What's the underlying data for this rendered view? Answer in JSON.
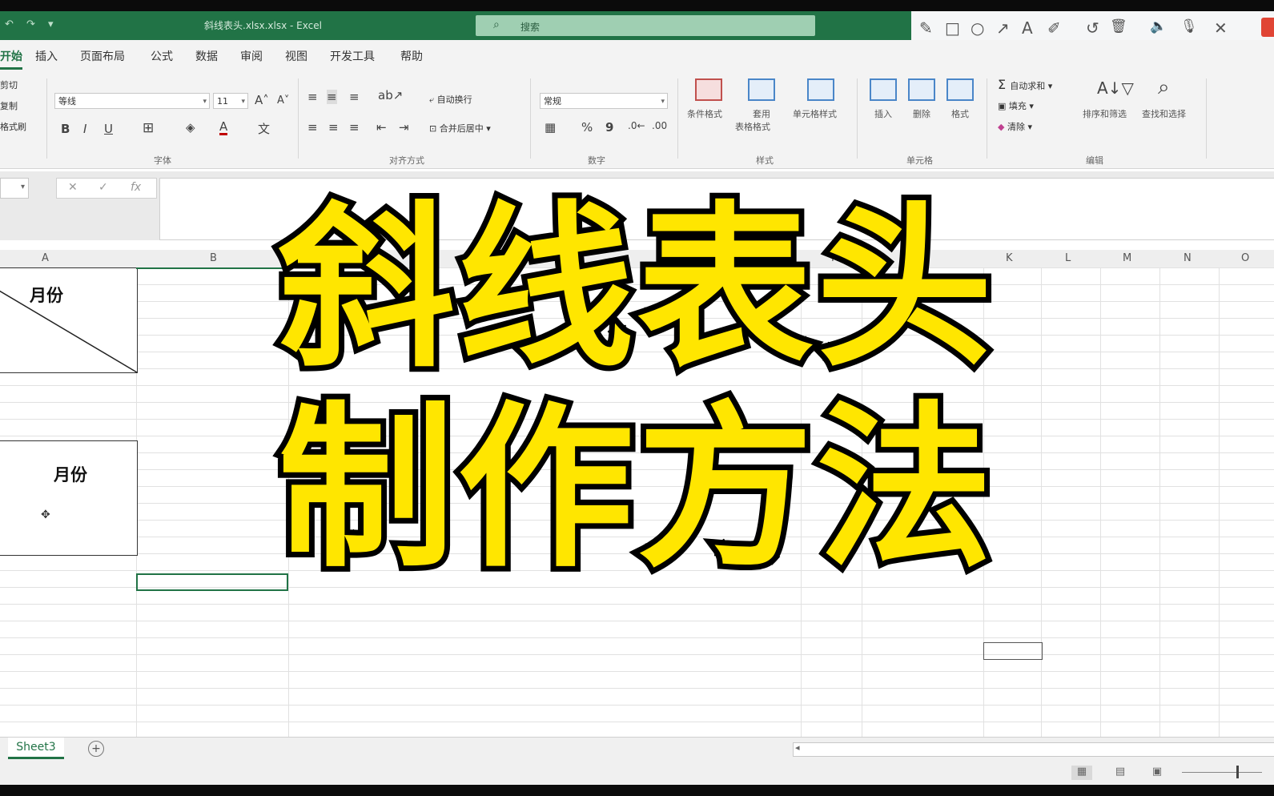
{
  "window": {
    "title": "斜线表头.xlsx.xlsx  -  Excel",
    "quick_access": "↶ ↷ ▾",
    "search_placeholder": "搜索"
  },
  "draw_toolbar": {
    "icons": [
      "pencil-icon",
      "rectangle-icon",
      "circle-icon",
      "arrow-icon",
      "text-icon",
      "highlighter-icon",
      "undo-icon",
      "trash-icon",
      "speaker-icon",
      "mic-icon",
      "close-icon"
    ],
    "glyphs": [
      "✎",
      "□",
      "○",
      "↗",
      "A",
      "✐",
      "↺",
      "🗑",
      "🔈",
      "🎙",
      "✕"
    ]
  },
  "tabs": [
    "开始",
    "插入",
    "页面布局",
    "公式",
    "数据",
    "审阅",
    "视图",
    "开发工具",
    "帮助"
  ],
  "ribbon": {
    "clipboard": {
      "cut": "剪切",
      "copy": "复制",
      "format_painter": "格式刷"
    },
    "font": {
      "name": "等线",
      "size": "11",
      "label": "字体",
      "grow": "A˄",
      "shrink": "A˅",
      "bold": "B",
      "italic": "I",
      "underline": "U"
    },
    "alignment": {
      "wrap": "自动换行",
      "merge": "合并后居中",
      "label": "对齐方式"
    },
    "number": {
      "format": "常规",
      "percent": "%",
      "comma": "9",
      "label": "数字"
    },
    "styles": {
      "conditional": "条件格式",
      "table_line1": "套用",
      "table_line2": "表格格式",
      "cell_styles": "单元格样式",
      "label": "样式"
    },
    "cells": {
      "insert": "插入",
      "delete": "删除",
      "format": "格式",
      "label": "单元格"
    },
    "editing": {
      "autosum": "自动求和",
      "fill": "填充",
      "clear": "清除",
      "sort": "排序和筛选",
      "find": "查找和选择",
      "label": "编辑"
    }
  },
  "formula_bar": {
    "fx": "fx",
    "cancel": "✕",
    "enter": "✓"
  },
  "columns": [
    "A",
    "B",
    "H",
    "K",
    "L",
    "M",
    "N",
    "O"
  ],
  "cells": {
    "header1": "月份",
    "header2": "月份",
    "faint": "份"
  },
  "sheet": {
    "tab": "Sheet3",
    "add": "+"
  },
  "overlay": {
    "line1": "斜线表头",
    "line2": "制作方法"
  }
}
